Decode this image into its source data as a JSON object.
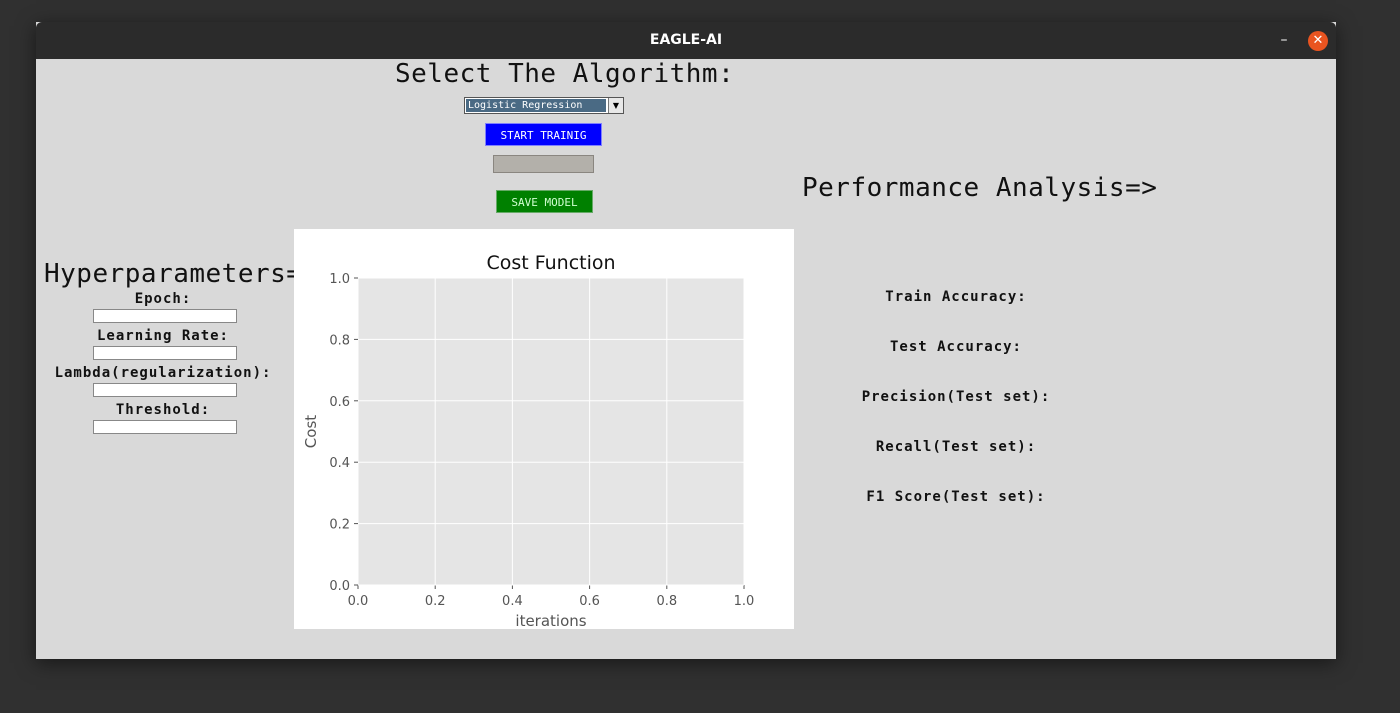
{
  "window": {
    "title": "EAGLE-AI",
    "minimize_glyph": "–",
    "close_glyph": "✕"
  },
  "algorithm": {
    "heading": "Select The Algorithm:",
    "selected": "Logistic Regression",
    "dropdown_arrow": "▼",
    "start_label": "START TRAINIG",
    "progress": 0,
    "save_label": "SAVE MODEL"
  },
  "hyperparameters": {
    "heading": "Hyperparameters=>",
    "fields": [
      {
        "label": "Epoch:",
        "value": ""
      },
      {
        "label": "Learning Rate:",
        "value": ""
      },
      {
        "label": "Lambda(regularization):",
        "value": ""
      },
      {
        "label": "Threshold:",
        "value": ""
      }
    ]
  },
  "performance": {
    "heading": "Performance Analysis=>",
    "metrics": [
      "Train Accuracy:",
      "Test Accuracy:",
      "Precision(Test set):",
      "Recall(Test set):",
      "F1 Score(Test set):"
    ]
  },
  "colors": {
    "start_button": "#0000ff",
    "save_button": "#008000",
    "close_button": "#e95420",
    "plot_background": "#e5e5e5"
  },
  "chart_data": {
    "type": "line",
    "title": "Cost Function",
    "xlabel": "iterations",
    "ylabel": "Cost",
    "xlim": [
      0.0,
      1.0
    ],
    "ylim": [
      0.0,
      1.0
    ],
    "xticks": [
      "0.0",
      "0.2",
      "0.4",
      "0.6",
      "0.8",
      "1.0"
    ],
    "yticks": [
      "0.0",
      "0.2",
      "0.4",
      "0.6",
      "0.8",
      "1.0"
    ],
    "grid": true,
    "series": []
  }
}
